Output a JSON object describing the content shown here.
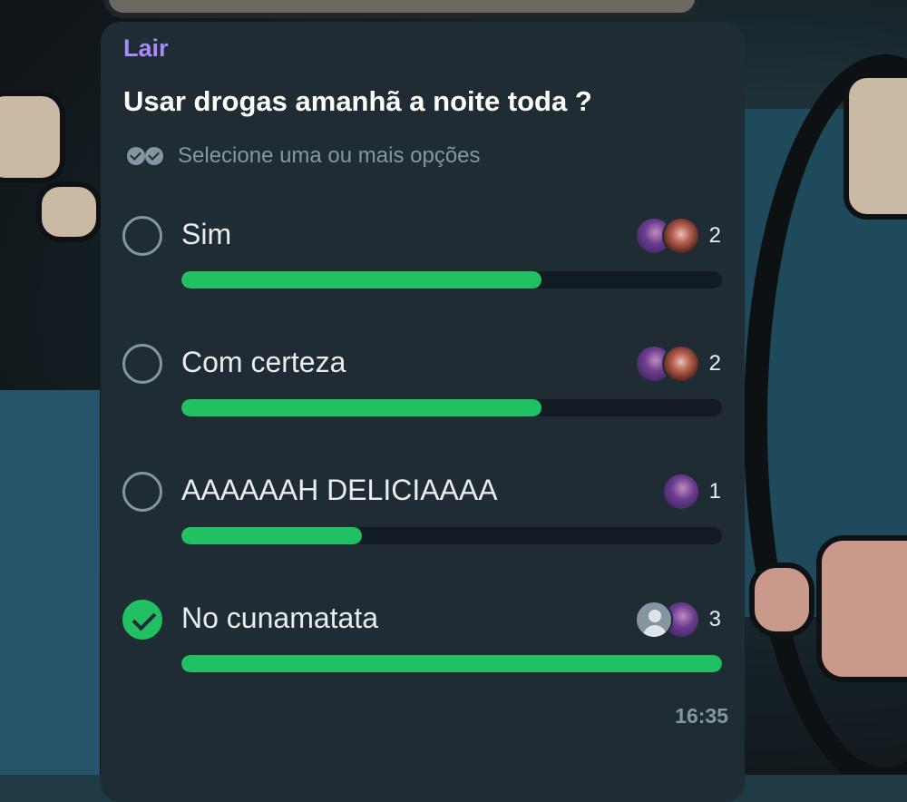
{
  "poll": {
    "sender": "Lair",
    "question": "Usar drogas amanhã a noite toda ?",
    "hint": "Selecione uma ou mais opções",
    "time": "16:35",
    "options": [
      {
        "label": "Sim",
        "votes": "2",
        "fraction": 0.6667,
        "selected": false,
        "voter_avatars": [
          "purple-photo",
          "red-photo"
        ]
      },
      {
        "label": "Com certeza",
        "votes": "2",
        "fraction": 0.6667,
        "selected": false,
        "voter_avatars": [
          "purple-photo",
          "red-photo"
        ]
      },
      {
        "label": "AAAAAAH DELICIAAAA",
        "votes": "1",
        "fraction": 0.3333,
        "selected": false,
        "voter_avatars": [
          "purple-photo"
        ]
      },
      {
        "label": "No cunamatata",
        "votes": "3",
        "fraction": 1.0,
        "selected": true,
        "voter_avatars": [
          "default-user",
          "purple-photo"
        ]
      }
    ]
  },
  "colors": {
    "bubble": "#1f2c33",
    "accent_green": "#21c063",
    "sender": "#a78bfa",
    "muted": "#8696a0"
  },
  "icons": {
    "hint": "double-check-icon",
    "unselected": "radio-empty-icon",
    "selected": "check-circle-icon"
  }
}
